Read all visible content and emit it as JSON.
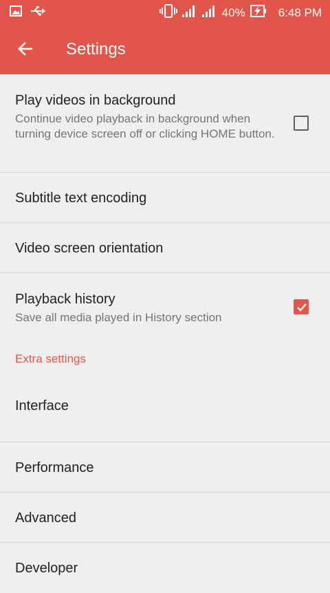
{
  "status_bar": {
    "battery": "40%",
    "time": "6:48 PM",
    "icons": [
      "gallery-icon",
      "usb-icon",
      "vibrate-icon",
      "signal-icon",
      "battery-charging-icon"
    ]
  },
  "toolbar": {
    "title": "Settings",
    "back_icon": "arrow-back-icon"
  },
  "settings": {
    "play_background": {
      "title": "Play videos in background",
      "summary": "Continue video playback in background when turning device screen off or clicking HOME button.",
      "checked": false
    },
    "subtitle_encoding": {
      "title": "Subtitle text encoding"
    },
    "screen_orientation": {
      "title": "Video screen orientation"
    },
    "playback_history": {
      "title": "Playback history",
      "summary": "Save all media played in History section",
      "checked": true
    }
  },
  "extra": {
    "header": "Extra settings",
    "interface": "Interface",
    "performance": "Performance",
    "advanced": "Advanced",
    "developer": "Developer"
  },
  "colors": {
    "accent": "#e2554a",
    "background": "#efefef",
    "divider": "#d6d6d6"
  }
}
